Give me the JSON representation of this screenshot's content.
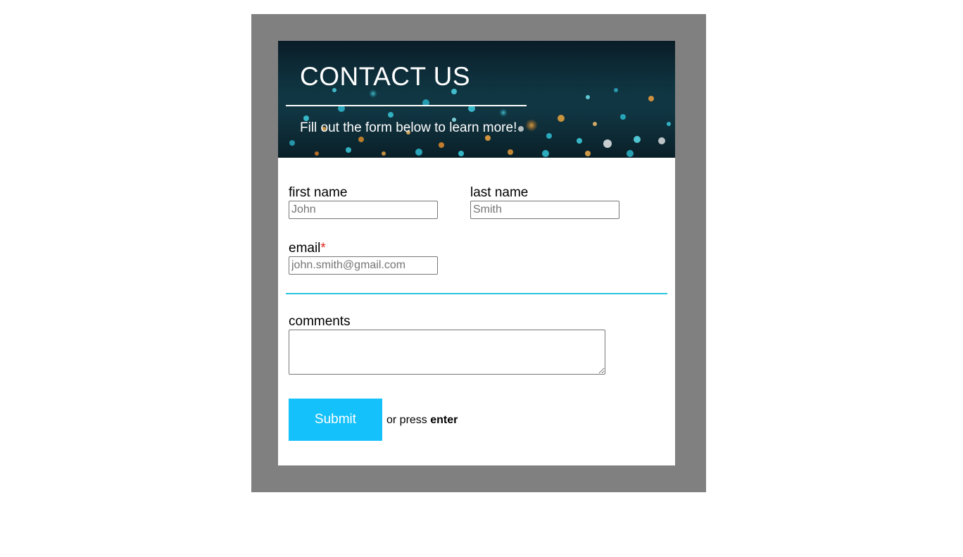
{
  "header": {
    "title": "CONTACT US",
    "subtitle": "Fill out the form below to learn more!"
  },
  "form": {
    "first_name": {
      "label": "first name",
      "placeholder": "John"
    },
    "last_name": {
      "label": "last name",
      "placeholder": "Smith"
    },
    "email": {
      "label": "email",
      "required_marker": "*",
      "placeholder": "john.smith@gmail.com"
    },
    "comments": {
      "label": "comments"
    },
    "submit": {
      "label": "Submit",
      "hint_prefix": "or press",
      "hint_key": "enter"
    }
  },
  "colors": {
    "frame": "#808080",
    "divider": "#27c6df",
    "submit_background": "#14c1fb",
    "required_marker": "#e0261b"
  }
}
